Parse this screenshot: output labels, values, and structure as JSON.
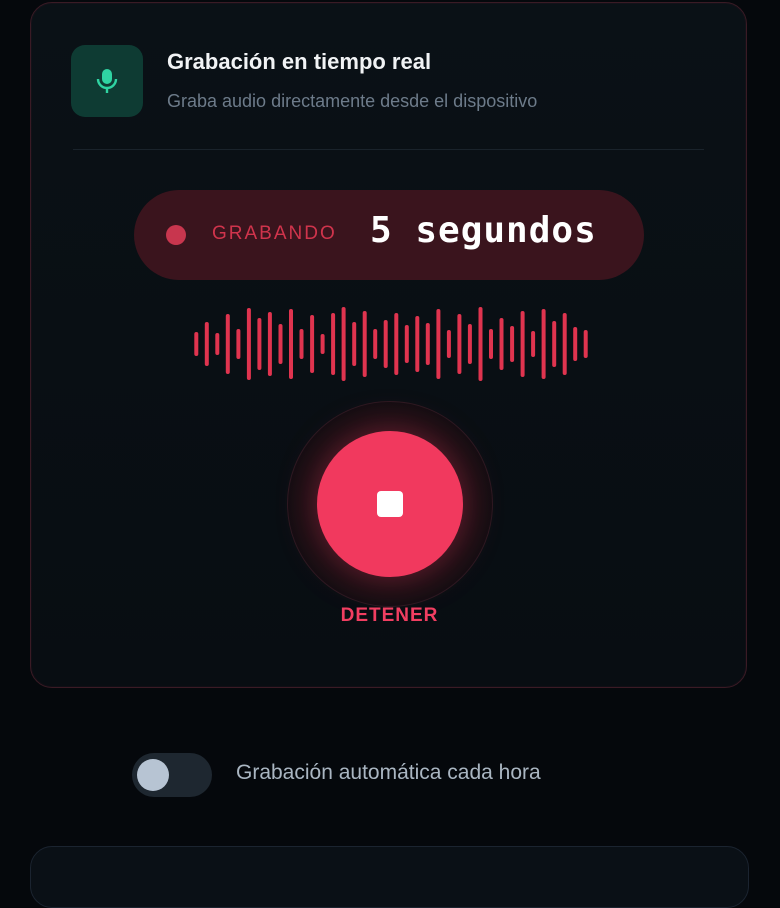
{
  "recorder": {
    "title": "Grabación en tiempo real",
    "subtitle": "Graba audio directamente desde el dispositivo",
    "status_label": "GRABANDO",
    "elapsed": "5 segundos",
    "stop_label": "DETENER",
    "accent_color": "#f1395e",
    "icon": "microphone-icon"
  },
  "auto_record": {
    "label": "Grabación automática cada hora",
    "enabled": false
  }
}
